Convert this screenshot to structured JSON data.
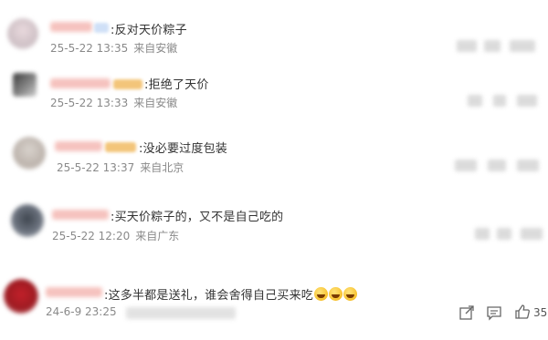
{
  "comments": [
    {
      "text": ":反对天价粽子",
      "time": "25-5-22 13:35",
      "location": "来自安徽"
    },
    {
      "text": ":拒绝了天价",
      "time": "25-5-22 13:33",
      "location": "来自安徽"
    },
    {
      "text": ":没必要过度包装",
      "time": "25-5-22 13:37",
      "location": "来自北京"
    },
    {
      "text": ":买天价粽子的，又不是自己吃的",
      "time": "25-5-22 12:20",
      "location": "来自广东"
    },
    {
      "text": ":这多半都是送礼，谁会舍得自己买来吃",
      "time": "24-6-9 23:25",
      "location": ""
    }
  ],
  "emojis": [
    "laugh-cry-emoji",
    "laugh-cry-emoji",
    "laugh-cry-emoji"
  ],
  "actions": {
    "like_count": "35"
  },
  "icons": {
    "share": "share-icon",
    "comment": "comment-icon",
    "like": "thumbs-up-icon"
  }
}
